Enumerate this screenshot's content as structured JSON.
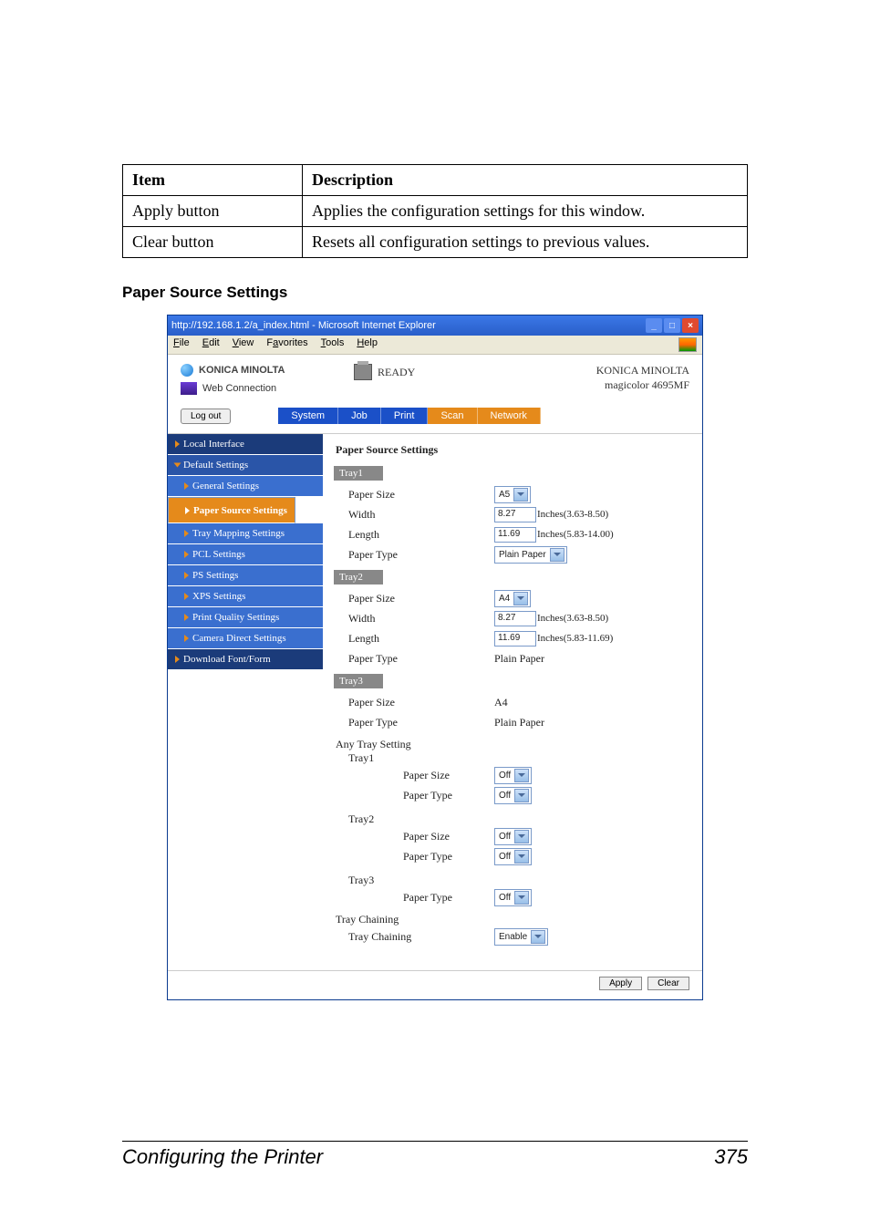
{
  "table": {
    "headers": [
      "Item",
      "Description"
    ],
    "rows": [
      [
        "Apply button",
        "Applies the configuration settings for this window."
      ],
      [
        "Clear button",
        "Resets all configuration settings to previous values."
      ]
    ]
  },
  "subhead": "Paper Source Settings",
  "ie": {
    "title": "http://192.168.1.2/a_index.html - Microsoft Internet Explorer",
    "menu": [
      "File",
      "Edit",
      "View",
      "Favorites",
      "Tools",
      "Help"
    ]
  },
  "header": {
    "brand": "KONICA MINOLTA",
    "prod": "Web Connection",
    "ready": "READY",
    "r1": "KONICA MINOLTA",
    "r2": "magicolor 4695MF",
    "logout": "Log out"
  },
  "tabs": [
    "System",
    "Job",
    "Print",
    "Scan",
    "Network"
  ],
  "nav": [
    {
      "label": "Local Interface",
      "cls": "dk"
    },
    {
      "label": "Default Settings",
      "cls": "md open"
    },
    {
      "label": "General Settings",
      "cls": "lt"
    },
    {
      "label": "Paper Source Settings",
      "cls": "sel"
    },
    {
      "label": "Tray Mapping Settings",
      "cls": "lt"
    },
    {
      "label": "PCL Settings",
      "cls": "lt"
    },
    {
      "label": "PS Settings",
      "cls": "lt"
    },
    {
      "label": "XPS Settings",
      "cls": "lt"
    },
    {
      "label": "Print Quality Settings",
      "cls": "lt"
    },
    {
      "label": "Camera Direct Settings",
      "cls": "lt"
    },
    {
      "label": "Download Font/Form",
      "cls": "dk"
    }
  ],
  "content": {
    "title": "Paper Source Settings",
    "tray1": {
      "name": "Tray1",
      "paperSize": "A5",
      "width": "8.27",
      "widthUnit": "Inches(3.63-8.50)",
      "length": "11.69",
      "lengthUnit": "Inches(5.83-14.00)",
      "paperType": "Plain Paper"
    },
    "tray2": {
      "name": "Tray2",
      "paperSize": "A4",
      "width": "8.27",
      "widthUnit": "Inches(3.63-8.50)",
      "length": "11.69",
      "lengthUnit": "Inches(5.83-11.69)",
      "paperType": "Plain Paper"
    },
    "tray3": {
      "name": "Tray3",
      "paperSize": "A4",
      "paperType": "Plain Paper"
    },
    "any": {
      "title": "Any Tray Setting",
      "t1": {
        "name": "Tray1",
        "paperSize": "Off",
        "paperType": "Off"
      },
      "t2": {
        "name": "Tray2",
        "paperSize": "Off",
        "paperType": "Off"
      },
      "t3": {
        "name": "Tray3",
        "paperType": "Off"
      }
    },
    "chain": {
      "title": "Tray Chaining",
      "label": "Tray Chaining",
      "value": "Enable"
    },
    "labels": {
      "paperSize": "Paper Size",
      "width": "Width",
      "length": "Length",
      "paperType": "Paper Type"
    },
    "buttons": {
      "apply": "Apply",
      "clear": "Clear"
    }
  },
  "footer": {
    "left": "Configuring the Printer",
    "right": "375"
  }
}
